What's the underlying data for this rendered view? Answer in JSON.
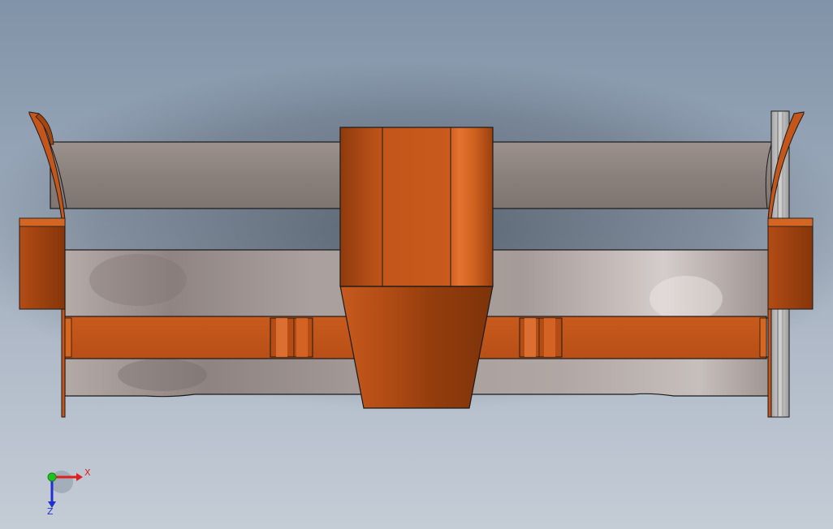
{
  "viewport": {
    "background_top": "#8193a8",
    "background_bottom": "#c4ccd6",
    "model": {
      "part_color": "#c4561b",
      "part_dark": "#943d0d",
      "part_light": "#e06e2b",
      "blade_color": "#9b8f8a",
      "edge_color": "#1a1a1a"
    }
  },
  "triad": {
    "x_label": "X",
    "z_label": "Z",
    "x_color": "#e02020",
    "y_color": "#22c022",
    "z_color": "#2030d0"
  }
}
